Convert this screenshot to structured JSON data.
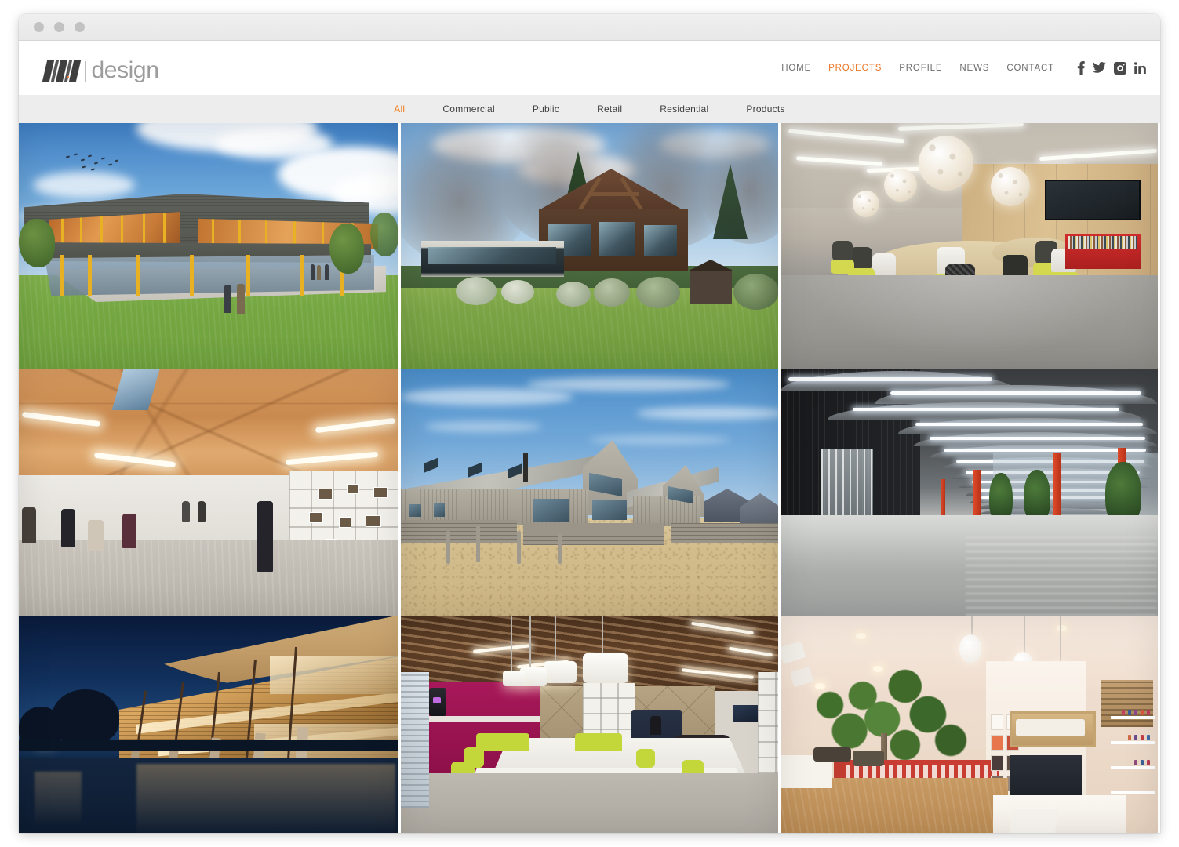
{
  "browser": {
    "traffic_lights": [
      "close",
      "minimize",
      "maximize"
    ]
  },
  "header": {
    "logo": {
      "mark": "wm-monogram",
      "word": "design",
      "separator": "|"
    },
    "nav": [
      {
        "label": "HOME",
        "active": false
      },
      {
        "label": "PROJECTS",
        "active": true
      },
      {
        "label": "PROFILE",
        "active": false
      },
      {
        "label": "NEWS",
        "active": false
      },
      {
        "label": "CONTACT",
        "active": false
      }
    ],
    "social": [
      {
        "name": "facebook-icon",
        "glyph": "f"
      },
      {
        "name": "twitter-icon",
        "glyph": "bird"
      },
      {
        "name": "instagram-icon",
        "glyph": "camera"
      },
      {
        "name": "linkedin-icon",
        "glyph": "in"
      }
    ]
  },
  "filters": [
    {
      "label": "All",
      "active": true
    },
    {
      "label": "Commercial",
      "active": false
    },
    {
      "label": "Public",
      "active": false
    },
    {
      "label": "Retail",
      "active": false
    },
    {
      "label": "Residential",
      "active": false
    },
    {
      "label": "Products",
      "active": false
    }
  ],
  "gallery": {
    "items": [
      {
        "id": 1,
        "alt": "Modern two-storey school building rendering with grey cladding, amber glazing and yellow columns on a green lawn"
      },
      {
        "id": 2,
        "alt": "Contemporary timber house with pitched roof set among bare trees and lawn"
      },
      {
        "id": 3,
        "alt": "Open-plan office with white spherical pendant lights, oval timber table and yellow chairs"
      },
      {
        "id": 4,
        "alt": "Collaborative workspace with faceted plywood ceiling, ochre sofas and white display shelving"
      },
      {
        "id": 5,
        "alt": "Timber-clad coastal houses with pitched roofs on sand and shingle beach"
      },
      {
        "id": 6,
        "alt": "Corridor with sculpted wave-form ceiling baffles, red columns and polished reflective floor"
      },
      {
        "id": 7,
        "alt": "Curved timber-clad building illuminated at dusk, reflected in a still water pool"
      },
      {
        "id": 8,
        "alt": "Office with magenta kitchenette, white drum pendants, lime green screens and slatted timber ceiling"
      },
      {
        "id": 9,
        "alt": "Retail and salon interior with indoor tree, red balustrade, pendant lights and product displays"
      }
    ]
  },
  "colors": {
    "accent": "#ec7424",
    "nav_text": "#6d6d6d",
    "filter_bar_bg": "#ededed",
    "header_bg": "#ffffff",
    "chrome_bg": "#ededed"
  }
}
